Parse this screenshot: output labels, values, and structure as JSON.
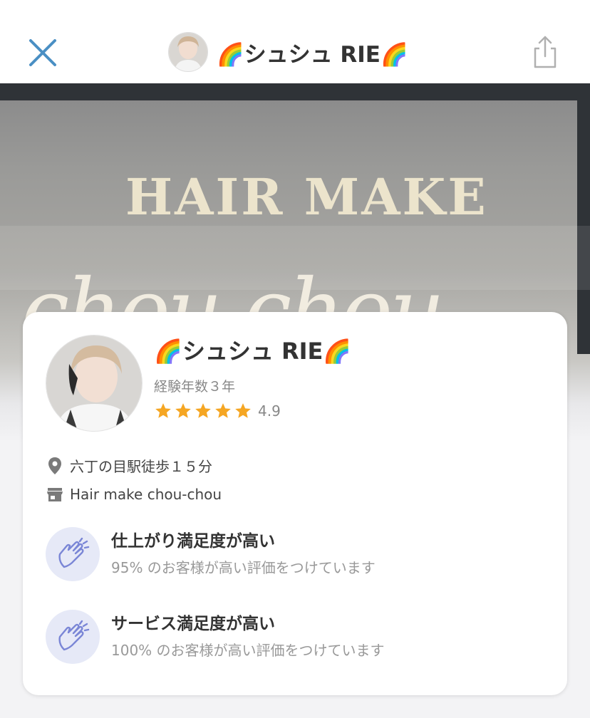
{
  "header": {
    "title": "🌈シュシュ RIE🌈",
    "close_icon": "close-icon",
    "share_icon": "share-icon"
  },
  "hero": {
    "sign_text": "HAIR MAKE",
    "script_text": "chou chou"
  },
  "profile": {
    "name": "🌈シュシュ RIE🌈",
    "experience": "経験年数３年",
    "rating": "4.9",
    "stars": 5,
    "access": "六丁の目駅徒歩１５分",
    "salon": "Hair  make  chou-chou"
  },
  "features": [
    {
      "title": "仕上がり満足度が高い",
      "subtitle": "95% のお客様が高い評価をつけています",
      "icon": "clapping-hands-icon"
    },
    {
      "title": "サービス満足度が高い",
      "subtitle": "100% のお客様が高い評価をつけています",
      "icon": "clapping-hands-icon"
    }
  ],
  "colors": {
    "accent": "#4a8fc4",
    "star": "#f5a623",
    "badge_bg": "#e6e9f7",
    "badge_icon": "#7a86d6"
  }
}
